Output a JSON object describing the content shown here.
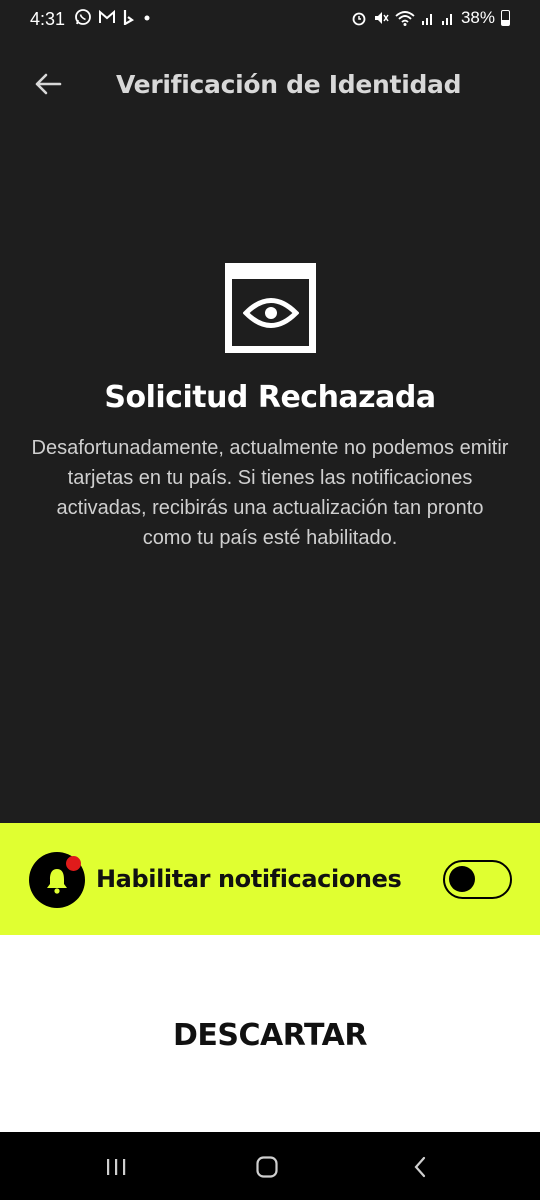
{
  "status_bar": {
    "time": "4:31",
    "battery": "38%",
    "left_icons": [
      "whatsapp-icon",
      "gmail-icon",
      "b-app-icon",
      "dot-icon"
    ],
    "right_icons": [
      "alarm-icon",
      "mute-icon",
      "wifi-icon",
      "signal-icon",
      "signal-icon"
    ]
  },
  "header": {
    "title": "Verificación de Identidad"
  },
  "main": {
    "heading": "Solicitud Rechazada",
    "description": "Desafortunadamente, actualmente no podemos emitir tarjetas en tu país. Si tienes las notificaciones activadas, recibirás una actualización tan pronto como tu país esté habilitado."
  },
  "notification": {
    "label": "Habilitar notificaciones",
    "enabled": false
  },
  "actions": {
    "dismiss_label": "DESCARTAR"
  },
  "colors": {
    "background": "#1e1e1e",
    "accent": "#e0ff31",
    "badge": "#e01b1b"
  }
}
